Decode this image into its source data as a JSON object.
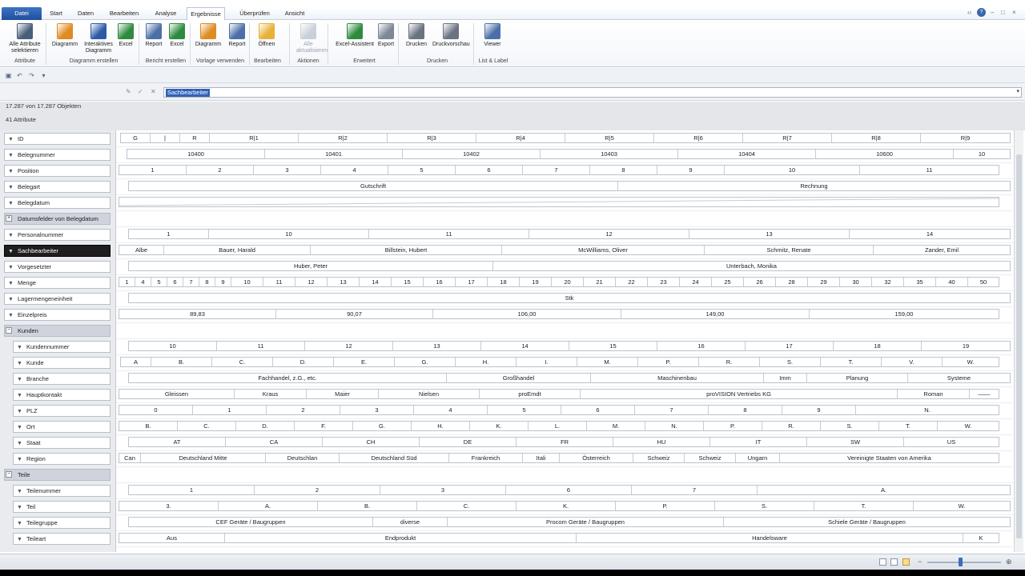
{
  "tabs": [
    "Datei",
    "Start",
    "Daten",
    "Bearbeiten",
    "Analyse",
    "Ergebnisse",
    "Überprüfen",
    "Ansicht"
  ],
  "window_controls": [
    "‹‹",
    "?",
    "–",
    "□",
    "×"
  ],
  "ribbon": {
    "buttons": [
      {
        "label": "Alle Attribute selektieren",
        "icon": "columns-icon",
        "color": "#4a5e7a",
        "enabled": true
      },
      {
        "label": "Diagramm",
        "icon": "chart-icon",
        "color": "#e08a22",
        "enabled": true
      },
      {
        "label": "Interaktives Diagramm",
        "icon": "interactive-chart-icon",
        "color": "#2c5aa6",
        "enabled": true
      },
      {
        "label": "Excel",
        "icon": "excel-icon",
        "color": "#2e8b3e",
        "enabled": true
      },
      {
        "label": "Report",
        "icon": "report-icon",
        "color": "#4d6fa8",
        "enabled": true
      },
      {
        "label": "Excel",
        "icon": "excel-icon",
        "color": "#2e8b3e",
        "enabled": true
      },
      {
        "label": "Diagramm",
        "icon": "chart-icon",
        "color": "#e08a22",
        "enabled": true
      },
      {
        "label": "Report",
        "icon": "report-icon",
        "color": "#4d6fa8",
        "enabled": true
      },
      {
        "label": "Öffnen",
        "icon": "folder-icon",
        "color": "#e7b23a",
        "enabled": true
      },
      {
        "label": "Alle aktualisieren",
        "icon": "refresh-icon",
        "color": "#9aa6b8",
        "enabled": false
      },
      {
        "label": "Excel-Assistent",
        "icon": "excel-wizard-icon",
        "color": "#2e8b3e",
        "enabled": true
      },
      {
        "label": "Export",
        "icon": "export-icon",
        "color": "#7d8796",
        "enabled": true
      },
      {
        "label": "Drucken",
        "icon": "printer-icon",
        "color": "#6b7380",
        "enabled": true
      },
      {
        "label": "Druckvorschau",
        "icon": "print-preview-icon",
        "color": "#6b7380",
        "enabled": true
      },
      {
        "label": "Viewer",
        "icon": "viewer-icon",
        "color": "#4a6fa8",
        "enabled": true
      }
    ],
    "groups": [
      "Attribute",
      "Diagramm erstellen",
      "Bericht erstellen",
      "Vorlage verwenden",
      "Bearbeiten",
      "Aktionen",
      "Erweitert",
      "Drucken",
      "List & Label"
    ]
  },
  "field_editor": {
    "value": "Sachbearbeiter"
  },
  "info": {
    "objects": "17.287 von 17.287 Objekten",
    "attributes": "41 Attribute"
  },
  "rows": [
    {
      "label": "ID",
      "cells": [
        "G",
        "|",
        "R",
        "R|1",
        "R|2",
        "R|3",
        "R|4",
        "R|5",
        "R|6",
        "R|7",
        "R|8",
        "R|9"
      ]
    },
    {
      "label": "Belegnummer",
      "cells": [
        "10400",
        "10401",
        "10402",
        "10403",
        "10404",
        "10600",
        "10"
      ]
    },
    {
      "label": "Position",
      "cells": [
        "1",
        "2",
        "3",
        "4",
        "5",
        "6",
        "7",
        "8",
        "9",
        "10",
        "11"
      ]
    },
    {
      "label": "Belegart",
      "cells": [
        "Gutschrift",
        "Rechnung"
      ]
    },
    {
      "label": "Belegdatum",
      "cells": []
    },
    {
      "label": "Datumsfelder von Belegdatum",
      "cells": []
    },
    {
      "label": "Personalnummer",
      "cells": [
        "1",
        "10",
        "11",
        "12",
        "13",
        "14"
      ]
    },
    {
      "label": "Sachbearbeiter",
      "cells": [
        "Albe",
        "Bauer, Harald",
        "Billstein, Hubert",
        "McWilliams, Oliver",
        "Schmitz, Renate",
        "Zander, Emil"
      ]
    },
    {
      "label": "Vorgesetzter",
      "cells": [
        "Huber, Peter",
        "Unterbach, Monika"
      ]
    },
    {
      "label": "Menge",
      "cells": [
        "1",
        "4",
        "5",
        "6",
        "7",
        "8",
        "9",
        "10",
        "11",
        "12",
        "13",
        "14",
        "15",
        "16",
        "17",
        "18",
        "19",
        "20",
        "21",
        "22",
        "23",
        "24",
        "25",
        "26",
        "28",
        "29",
        "30",
        "32",
        "35",
        "40",
        "50"
      ]
    },
    {
      "label": "Lagermengeneinheit",
      "cells": [
        "Stk"
      ]
    },
    {
      "label": "Einzelpreis",
      "cells": [
        "89,83",
        "90,07",
        "106,00",
        "149,00",
        "159,00"
      ]
    },
    {
      "label": "Kunden",
      "cells": []
    },
    {
      "label": "Kundennummer",
      "cells": [
        "10",
        "11",
        "12",
        "13",
        "14",
        "15",
        "16",
        "17",
        "18",
        "19"
      ]
    },
    {
      "label": "Kunde",
      "cells": [
        "A",
        "B.",
        "C.",
        "D.",
        "E.",
        "G.",
        "H.",
        "I.",
        "M.",
        "P.",
        "R.",
        "S.",
        "T.",
        "V.",
        "W."
      ]
    },
    {
      "label": "Branche",
      "cells": [
        "Fachhandel, z.G., etc.",
        "Großhandel",
        "Maschinenbau",
        "Imm",
        "Planung",
        "Systeme"
      ]
    },
    {
      "label": "Hauptkontakt",
      "cells": [
        "Gleissen",
        "Kraus",
        "Maier",
        "Nielsen",
        "proEmdt",
        "proVISION Vertriebs KG",
        "Roman",
        "——"
      ]
    },
    {
      "label": "PLZ",
      "cells": [
        "0",
        "1",
        "2",
        "3",
        "4",
        "5",
        "6",
        "7",
        "8",
        "9",
        "N."
      ]
    },
    {
      "label": "Ort",
      "cells": [
        "B.",
        "C.",
        "D.",
        "F.",
        "G.",
        "H.",
        "K.",
        "L.",
        "M.",
        "N.",
        "P.",
        "R.",
        "S.",
        "T.",
        "W."
      ]
    },
    {
      "label": "Staat",
      "cells": [
        "AT",
        "CA",
        "CH",
        "DE",
        "FR",
        "HU",
        "IT",
        "SW",
        "US"
      ]
    },
    {
      "label": "Region",
      "cells": [
        "Can",
        "Deutschland Mitte",
        "Deutschlan",
        "Deutschland Süd",
        "Frankreich",
        "Itali",
        "Österreich",
        "Schweiz",
        "Schweiz",
        "Ungarn",
        "Vereinigte Staaten von Amerika"
      ]
    },
    {
      "label": "Teile",
      "cells": []
    },
    {
      "label": "Teilenummer",
      "cells": [
        "1",
        "2",
        "3",
        "6",
        "7",
        "A."
      ]
    },
    {
      "label": "Teil",
      "cells": [
        "3.",
        "A.",
        "B.",
        "C.",
        "K.",
        "P.",
        "S.",
        "T.",
        "W."
      ]
    },
    {
      "label": "Teilegruppe",
      "cells": [
        "CEF Geräte / Baugruppen",
        "diverse",
        "Procom Geräte / Baugruppen",
        "Schiele Geräte / Baugruppen"
      ]
    },
    {
      "label": "Teileart",
      "cells": [
        "Aus",
        "Endprodukt",
        "Handelsware",
        "K"
      ]
    }
  ],
  "colors": {
    "file_tab": "#2458a8",
    "selection": "#2f62b9",
    "selected_row": "#1e1e1e"
  }
}
